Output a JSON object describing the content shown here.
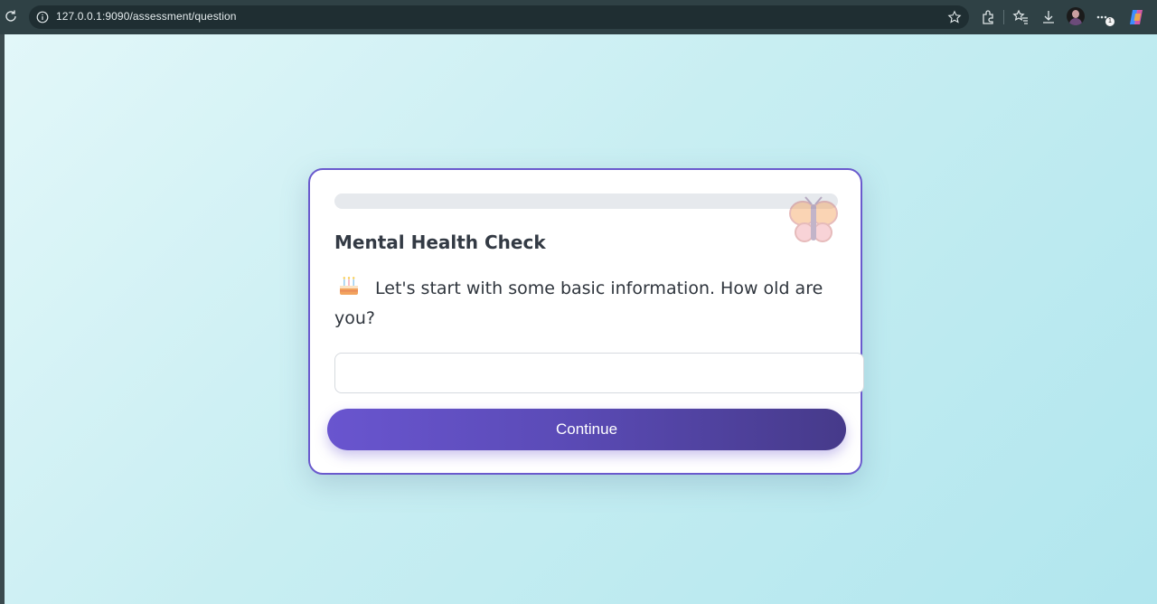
{
  "browser": {
    "url": "127.0.0.1:9090/assessment/question",
    "profile_badge": "1"
  },
  "icons": {
    "reload": "reload-icon",
    "info": "info-icon",
    "star": "star-icon",
    "extensions": "extensions-icon",
    "favorites": "favorites-icon",
    "downloads": "download-icon",
    "more": "more-icon",
    "copilot": "copilot-icon",
    "butterfly": "butterfly-icon",
    "cake": "birthday-cake-icon"
  },
  "assessment": {
    "title": "Mental Health Check",
    "question": "Let's start with some basic information. How old are you?",
    "answer_value": "",
    "progress": 0,
    "continue_label": "Continue"
  },
  "colors": {
    "accent": "#6a5acd",
    "button_start": "#6955cf",
    "button_end": "#463a8a",
    "background": "#c8eef2"
  }
}
